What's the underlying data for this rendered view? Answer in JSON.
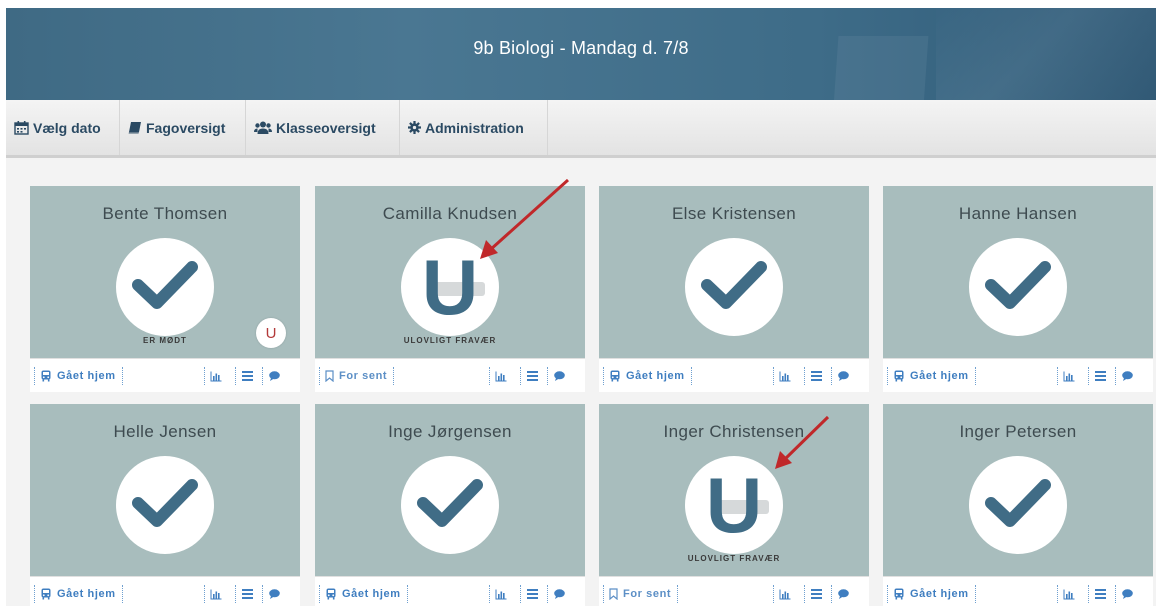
{
  "header": {
    "title": "9b Biologi - Mandag d. 7/8"
  },
  "nav": [
    {
      "label": "Vælg dato",
      "icon": "calendar-icon"
    },
    {
      "label": "Fagoversigt",
      "icon": "book-icon"
    },
    {
      "label": "Klasseoversigt",
      "icon": "users-icon"
    },
    {
      "label": "Administration",
      "icon": "gear-icon"
    }
  ],
  "students": [
    {
      "name": "Bente Thomsen",
      "status": "present",
      "status_label": "ER MØDT",
      "badge": "U",
      "action_label": "Gået hjem",
      "action_icon": "bus-icon"
    },
    {
      "name": "Camilla Knudsen",
      "status": "absent",
      "status_label": "ULOVLIGT FRAVÆR",
      "symbol": "U",
      "action_label": "For sent",
      "action_icon": "bookmark-icon"
    },
    {
      "name": "Else Kristensen",
      "status": "present",
      "status_label": "",
      "action_label": "Gået hjem",
      "action_icon": "bus-icon"
    },
    {
      "name": "Hanne Hansen",
      "status": "present",
      "status_label": "",
      "action_label": "Gået hjem",
      "action_icon": "bus-icon"
    },
    {
      "name": "Helle Jensen",
      "status": "present",
      "status_label": "",
      "action_label": "Gået hjem",
      "action_icon": "bus-icon"
    },
    {
      "name": "Inge Jørgensen",
      "status": "present",
      "status_label": "",
      "action_label": "Gået hjem",
      "action_icon": "bus-icon"
    },
    {
      "name": "Inger Christensen",
      "status": "absent",
      "status_label": "ULOVLIGT FRAVÆR",
      "symbol": "U",
      "action_label": "For sent",
      "action_icon": "bookmark-icon"
    },
    {
      "name": "Inger Petersen",
      "status": "present",
      "status_label": "",
      "action_label": "Gået hjem",
      "action_icon": "bus-icon"
    }
  ],
  "colors": {
    "header": "#4a7792",
    "card_top": "#a8bdbd",
    "check": "#406c86",
    "link": "#3f7ec0",
    "annotation_arrow": "#c0282a"
  }
}
